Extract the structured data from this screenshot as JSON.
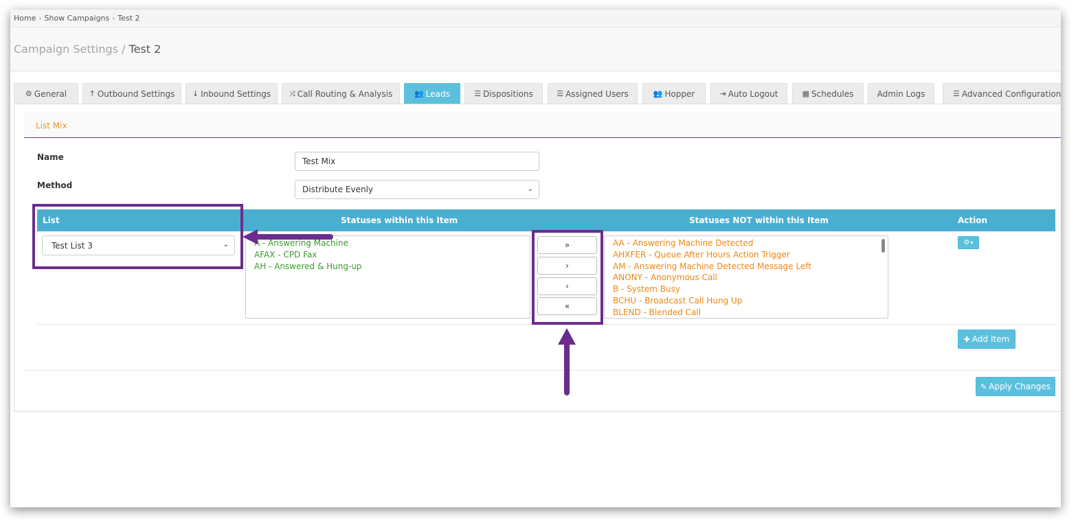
{
  "breadcrumb": {
    "items": [
      "Home",
      "Show Campaigns",
      "Test 2"
    ],
    "separator": "›"
  },
  "page_title": {
    "parent": "Campaign Settings",
    "divider": "/",
    "current": "Test 2"
  },
  "tabs": [
    {
      "label": "General",
      "icon": "cogs-icon",
      "glyph": "⚙"
    },
    {
      "label": "Outbound Settings",
      "icon": "arrow-up-icon",
      "glyph": "↑"
    },
    {
      "label": "Inbound Settings",
      "icon": "arrow-down-icon",
      "glyph": "↓"
    },
    {
      "label": "Call Routing & Analysis",
      "icon": "random-icon",
      "glyph": "⤨"
    },
    {
      "label": "Leads",
      "icon": "users-icon",
      "glyph": "👥",
      "active": true
    },
    {
      "label": "Dispositions",
      "icon": "list-icon",
      "glyph": "☰"
    },
    {
      "label": "Assigned Users",
      "icon": "list-ol-icon",
      "glyph": "☰"
    },
    {
      "label": "Hopper",
      "icon": "users-icon",
      "glyph": "👥"
    },
    {
      "label": "Auto Logout",
      "icon": "sign-out-icon",
      "glyph": "⇥"
    },
    {
      "label": "Schedules",
      "icon": "calendar-icon",
      "glyph": "▦"
    },
    {
      "label": "Admin Logs",
      "icon": "",
      "glyph": ""
    },
    {
      "label": "Advanced Configurations",
      "icon": "tasks-icon",
      "glyph": "☰",
      "caret": "▾"
    }
  ],
  "section": {
    "title": "List Mix"
  },
  "form": {
    "name_label": "Name",
    "name_value": "Test Mix",
    "method_label": "Method",
    "method_value": "Distribute Evenly"
  },
  "table": {
    "headers": {
      "list": "List",
      "within": "Statuses within this Item",
      "not_within": "Statuses NOT within this Item",
      "action": "Action"
    },
    "list_value": "Test List 3",
    "within_statuses": [
      "A - Answering Machine",
      "AFAX - CPD Fax",
      "AH - Answered & Hung-up"
    ],
    "not_within_statuses": [
      "AA - Answering Machine Detected",
      "AHXFER - Queue After Hours Action Trigger",
      "AM - Answering Machine Detected Message Left",
      "ANONY - Anonymous Call",
      "B - System Busy",
      "BCHU - Broadcast Call Hung Up",
      "BLEND - Blended Call"
    ],
    "move_buttons": {
      "move_all_right": "»",
      "move_right": "›",
      "move_left": "‹",
      "move_all_left": "«"
    },
    "action_button": {
      "icon": "gear-icon",
      "glyph": "⚙",
      "caret": "▾"
    }
  },
  "buttons": {
    "add_item": "Add Item",
    "add_item_glyph": "✚",
    "apply_changes": "Apply Changes",
    "apply_changes_glyph": "✎"
  },
  "colors": {
    "accent": "#5bc0de",
    "table_header": "#4aaed1",
    "highlight": "#6a2d8c",
    "status_within": "#3c9a2e",
    "status_not_within": "#f0860f",
    "section_title": "#e8952b"
  }
}
